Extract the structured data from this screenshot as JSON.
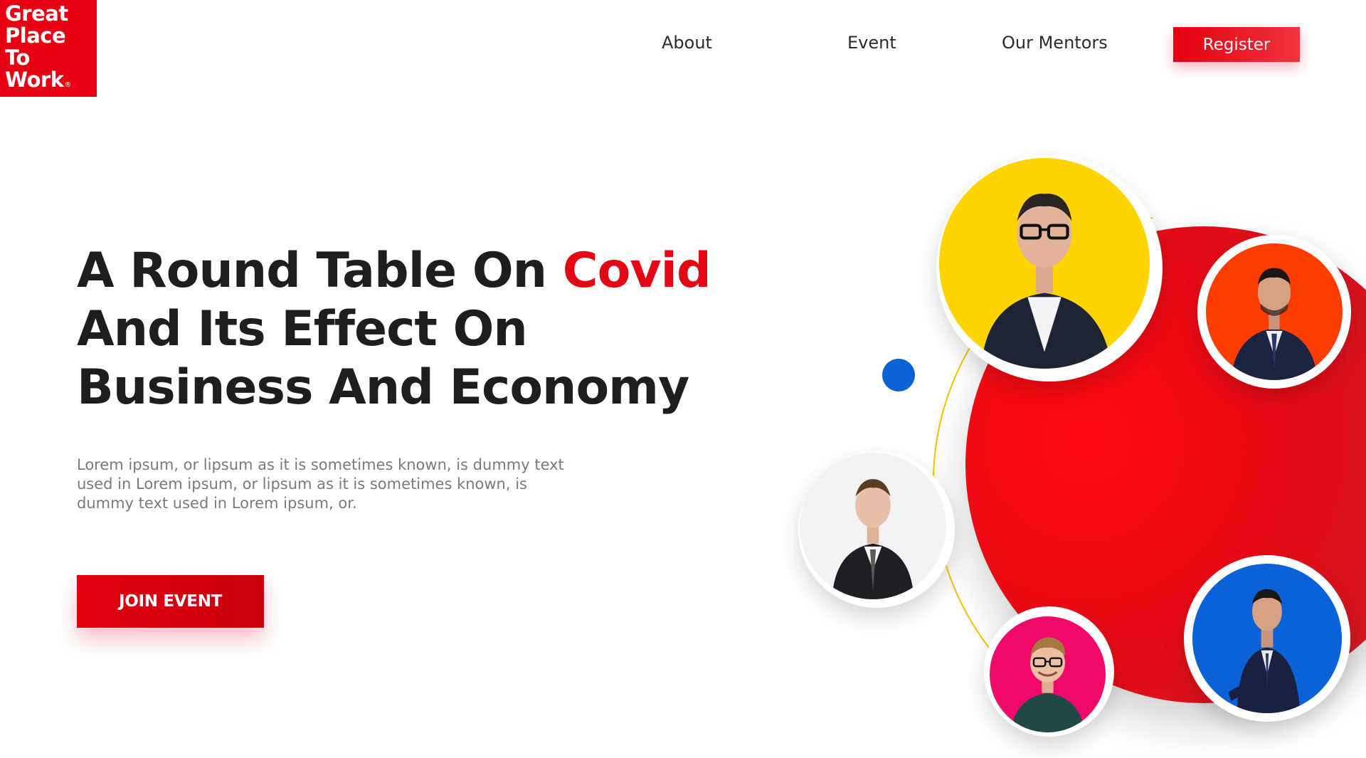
{
  "logo": {
    "lines": [
      "Great",
      "Place",
      "To",
      "Work"
    ],
    "registered_mark": "®",
    "color": "#e60012"
  },
  "nav": {
    "items": [
      {
        "label": "About"
      },
      {
        "label": "Event"
      },
      {
        "label": "Our Mentors"
      }
    ],
    "register_label": "Register"
  },
  "hero": {
    "title_before": "A Round Table On ",
    "title_accent": "Covid",
    "title_after": " And Its Effect On Business And Economy",
    "description": "Lorem ipsum, or lipsum as it is sometimes known, is dummy text used in Lorem ipsum, or lipsum as it is sometimes known, is dummy text used in Lorem ipsum, or.",
    "cta_label": "JOIN EVENT"
  },
  "mentors": [
    {
      "name": "mentor-photo-1",
      "bg_color": "#ffd400"
    },
    {
      "name": "mentor-photo-2",
      "bg_color": "#ff3d00"
    },
    {
      "name": "mentor-photo-3",
      "bg_color": "#f2f3f4"
    },
    {
      "name": "mentor-photo-4",
      "bg_color": "#f0086b"
    },
    {
      "name": "mentor-photo-5",
      "bg_color": "#0a62d6"
    }
  ],
  "colors": {
    "accent": "#e30613",
    "dark_text": "#1e1e1e",
    "muted_text": "#7a7a7a",
    "orbit_line": "#f2c200",
    "blue_dot": "#0d63d6"
  }
}
